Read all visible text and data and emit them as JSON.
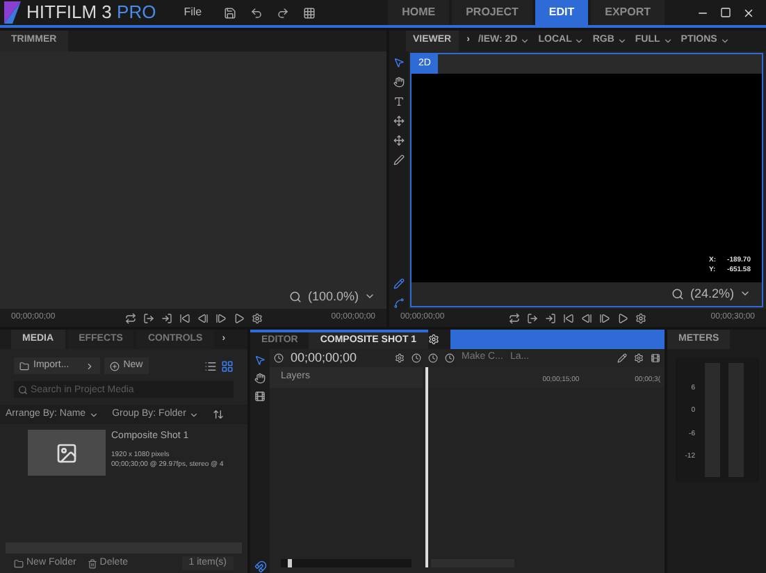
{
  "app": {
    "name": "HITFILM 3",
    "edition": "PRO",
    "menu": "File"
  },
  "workspace_tabs": [
    {
      "label": "HOME",
      "selected": false
    },
    {
      "label": "PROJECT",
      "selected": false
    },
    {
      "label": "EDIT",
      "selected": true
    },
    {
      "label": "EXPORT",
      "selected": false
    }
  ],
  "trimmer": {
    "title": "TRIMMER",
    "zoom": "(100.0%)",
    "time_start": "00;00;00;00",
    "time_end": "00;00;00;00"
  },
  "viewer": {
    "title": "VIEWER",
    "more": "›",
    "dropdowns": [
      "/IEW: 2D",
      "LOCAL",
      "RGB",
      "FULL",
      "PTIONS"
    ],
    "mode": "2D",
    "x_label": "X:",
    "x_value": "-189.70",
    "y_label": "Y:",
    "y_value": "-651.58",
    "zoom": "(24.2%)",
    "time_start": "00;00;00;00",
    "time_end": "00;00;30;00"
  },
  "media": {
    "tabs": [
      {
        "label": "MEDIA",
        "selected": true
      },
      {
        "label": "EFFECTS",
        "selected": false
      },
      {
        "label": "CONTROLS",
        "selected": false
      }
    ],
    "more": "›",
    "import": "Import...",
    "new": "New",
    "search_placeholder": "Search in Project Media",
    "arrange": "Arrange By: Name",
    "group": "Group By: Folder",
    "items": [
      {
        "name": "Composite Shot 1",
        "size": "1920 x 1080 pixels",
        "info": "00;00;30;00 @ 29.97fps, stereo @ 4"
      }
    ],
    "new_folder": "New Folder",
    "delete": "Delete",
    "count": "1 item(s)"
  },
  "timeline": {
    "tabs": [
      {
        "label": "EDITOR",
        "selected": false
      },
      {
        "label": "COMPOSITE SHOT 1",
        "selected": true
      }
    ],
    "zoom_slider": {
      "level": 0.05
    },
    "time": "00;00;00;00",
    "make": "Make C...",
    "layer": "La...",
    "layers": "Layers",
    "ruler": [
      "00;00;15;00",
      "00;00;3("
    ]
  },
  "meters": {
    "title": "METERS",
    "scale": [
      "6",
      "0",
      "-6",
      "-12"
    ]
  }
}
